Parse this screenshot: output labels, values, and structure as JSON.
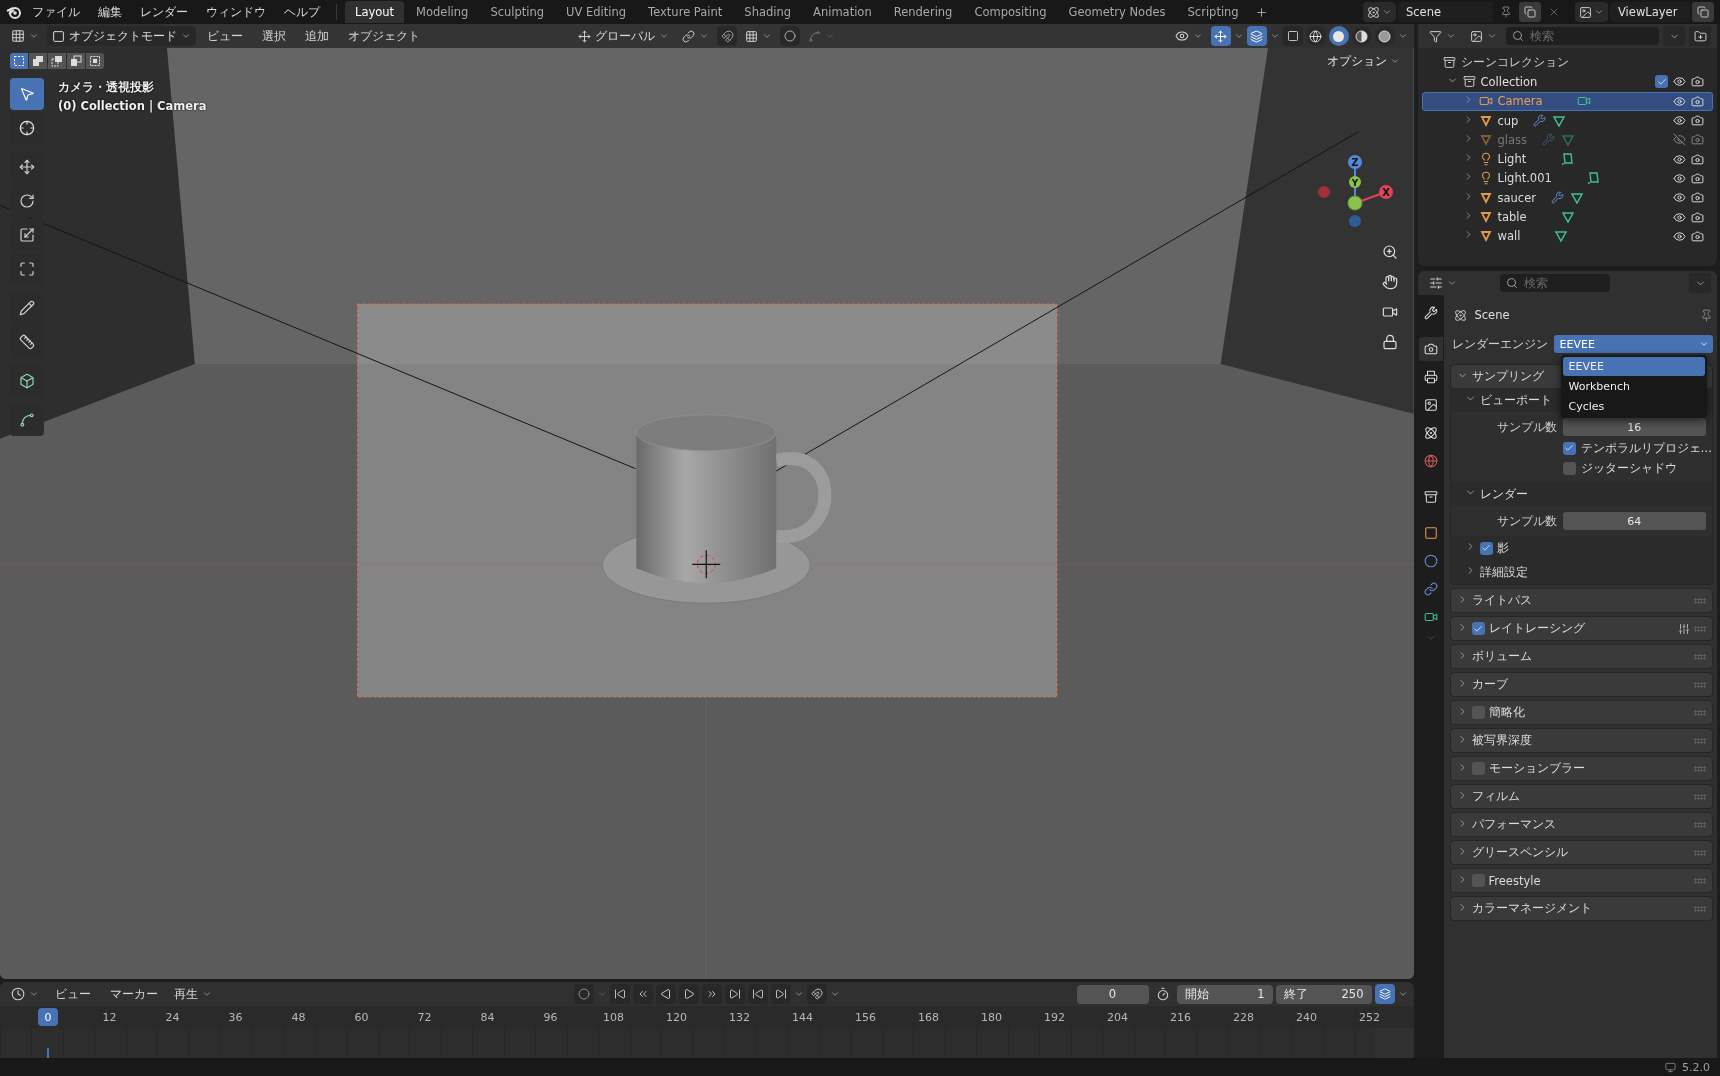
{
  "topbar": {
    "menus": [
      "ファイル",
      "編集",
      "レンダー",
      "ウィンドウ",
      "ヘルプ"
    ],
    "workspaces": [
      {
        "label": "Layout",
        "selected": true
      },
      {
        "label": "Modeling",
        "selected": false
      },
      {
        "label": "Sculpting",
        "selected": false
      },
      {
        "label": "UV Editing",
        "selected": false
      },
      {
        "label": "Texture Paint",
        "selected": false
      },
      {
        "label": "Shading",
        "selected": false
      },
      {
        "label": "Animation",
        "selected": false
      },
      {
        "label": "Rendering",
        "selected": false
      },
      {
        "label": "Compositing",
        "selected": false
      },
      {
        "label": "Geometry Nodes",
        "selected": false
      },
      {
        "label": "Scripting",
        "selected": false
      }
    ],
    "scene": "Scene",
    "view_layer": "ViewLayer"
  },
  "viewport": {
    "mode": "オブジェクトモード",
    "menus": [
      "ビュー",
      "選択",
      "追加",
      "オブジェクト"
    ],
    "orientation": "グローバル",
    "options": "オプション",
    "overlay_title": "カメラ・透視投影",
    "overlay_subtitle": "(0) Collection | Camera",
    "select_modes": [
      {
        "kind": "set",
        "selected": true
      },
      {
        "kind": "extend",
        "selected": false
      },
      {
        "kind": "subtract",
        "selected": false
      },
      {
        "kind": "difference",
        "selected": false
      },
      {
        "kind": "intersect",
        "selected": false
      }
    ],
    "tools": [
      {
        "kind": "select",
        "selected": true
      },
      {
        "kind": "cursor",
        "selected": false
      },
      {
        "kind": "move",
        "selected": false
      },
      {
        "kind": "rotate",
        "selected": false
      },
      {
        "kind": "scale",
        "selected": false
      },
      {
        "kind": "transform",
        "selected": false
      },
      {
        "kind": "annotate",
        "selected": false
      },
      {
        "kind": "measure",
        "selected": false
      },
      {
        "kind": "add-cube",
        "selected": false
      },
      {
        "kind": "curve",
        "selected": false
      }
    ],
    "shading": [
      {
        "kind": "wireframe",
        "selected": false
      },
      {
        "kind": "solid",
        "selected": true
      },
      {
        "kind": "material",
        "selected": false
      },
      {
        "kind": "rendered",
        "selected": false
      }
    ],
    "gizmo": {
      "x": "X",
      "y": "Y",
      "z": "Z"
    }
  },
  "outliner": {
    "search_placeholder": "検索",
    "root": "シーンコレクション",
    "collection": {
      "name": "Collection",
      "expanded": true,
      "checked": true,
      "children": [
        {
          "name": "Camera",
          "kind": "camera",
          "selected": true,
          "expanded": false,
          "visible": true,
          "modifier": false
        },
        {
          "name": "cup",
          "kind": "mesh",
          "selected": false,
          "expanded": false,
          "visible": true,
          "modifier": true
        },
        {
          "name": "glass",
          "kind": "mesh",
          "selected": false,
          "expanded": false,
          "visible": false,
          "modifier": true
        },
        {
          "name": "Light",
          "kind": "light",
          "selected": false,
          "expanded": false,
          "visible": true,
          "modifier": false
        },
        {
          "name": "Light.001",
          "kind": "light",
          "selected": false,
          "expanded": false,
          "visible": true,
          "modifier": false
        },
        {
          "name": "saucer",
          "kind": "mesh",
          "selected": false,
          "expanded": false,
          "visible": true,
          "modifier": true
        },
        {
          "name": "table",
          "kind": "mesh",
          "selected": false,
          "expanded": false,
          "visible": true,
          "modifier": false
        },
        {
          "name": "wall",
          "kind": "mesh",
          "selected": false,
          "expanded": false,
          "visible": true,
          "modifier": false
        }
      ]
    }
  },
  "properties": {
    "search_placeholder": "検索",
    "tabs": [
      {
        "kind": "tool",
        "selected": false
      },
      {
        "kind": "render",
        "selected": true
      },
      {
        "kind": "output",
        "selected": false
      },
      {
        "kind": "view-layer",
        "selected": false
      },
      {
        "kind": "scene",
        "selected": false
      },
      {
        "kind": "world",
        "selected": false
      },
      {
        "kind": "collection",
        "selected": false
      },
      {
        "kind": "object",
        "selected": false
      },
      {
        "kind": "physics",
        "selected": false
      },
      {
        "kind": "constraints",
        "selected": false
      },
      {
        "kind": "data",
        "selected": false
      }
    ],
    "context": "Scene",
    "engine_label": "レンダーエンジン",
    "engine": "EEVEE",
    "engine_menu": [
      {
        "label": "EEVEE",
        "selected": true
      },
      {
        "label": "Workbench",
        "selected": false
      },
      {
        "label": "Cycles",
        "selected": false
      }
    ],
    "sampling": {
      "label": "サンプリング",
      "expanded": true,
      "groups": [
        {
          "label": "ビューポート",
          "expanded": true,
          "samples_label": "サンプル数",
          "samples": "16",
          "options": [
            {
              "label": "テンポラルリプロジェ…",
              "checked": true
            },
            {
              "label": "ジッターシャドウ",
              "checked": false
            }
          ]
        },
        {
          "label": "レンダー",
          "expanded": true,
          "samples_label": "サンプル数",
          "samples": "64"
        }
      ],
      "subpanels": [
        {
          "kind": "checkbox",
          "label": "影",
          "checked": true,
          "expanded": false
        },
        {
          "kind": "plain",
          "label": "詳細設定",
          "expanded": false
        }
      ]
    },
    "panels": [
      {
        "kind": "plain",
        "label": "ライトパス",
        "expanded": false
      },
      {
        "kind": "checkbox",
        "label": "レイトレーシング",
        "checked": true,
        "expanded": false
      },
      {
        "kind": "plain",
        "label": "ボリューム",
        "expanded": false
      },
      {
        "kind": "plain",
        "label": "カーブ",
        "expanded": false
      },
      {
        "kind": "checkbox",
        "label": "簡略化",
        "checked": false,
        "expanded": false
      },
      {
        "kind": "plain",
        "label": "被写界深度",
        "expanded": false
      },
      {
        "kind": "checkbox",
        "label": "モーションブラー",
        "checked": false,
        "expanded": false
      },
      {
        "kind": "plain",
        "label": "フィルム",
        "expanded": false
      },
      {
        "kind": "plain",
        "label": "パフォーマンス",
        "expanded": false
      },
      {
        "kind": "plain",
        "label": "グリースペンシル",
        "expanded": false
      },
      {
        "kind": "checkbox",
        "label": "Freestyle",
        "checked": false,
        "expanded": false
      },
      {
        "kind": "plain",
        "label": "カラーマネージメント",
        "expanded": false
      }
    ]
  },
  "timeline": {
    "menus": [
      "ビュー",
      "マーカー",
      "再生"
    ],
    "current_frame": "0",
    "start_label": "開始",
    "start": "1",
    "end_label": "終了",
    "end": "250",
    "playhead": "0",
    "ticks": [
      "12",
      "24",
      "36",
      "48",
      "60",
      "72",
      "84",
      "96",
      "108",
      "120",
      "132",
      "144",
      "156",
      "168",
      "180",
      "192",
      "204",
      "216",
      "228",
      "240",
      "252"
    ]
  },
  "status_bar": {
    "version": "5.2.0"
  }
}
